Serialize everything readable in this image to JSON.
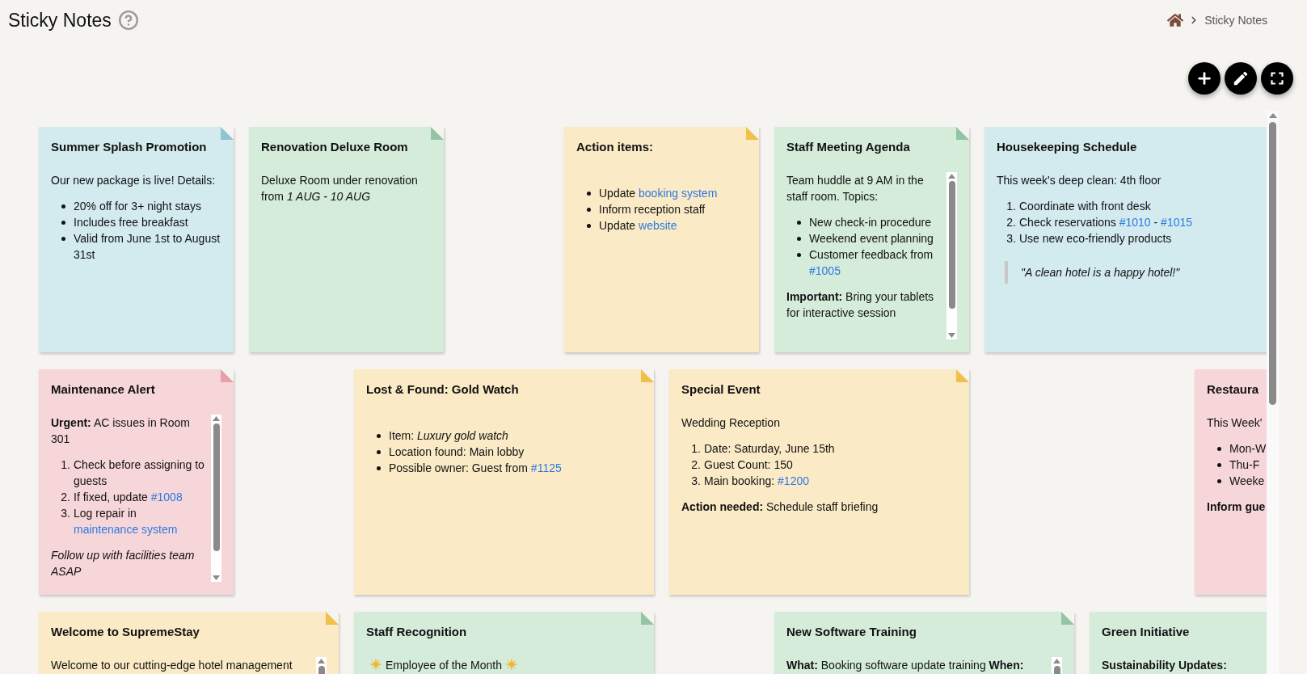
{
  "header": {
    "title": "Sticky Notes",
    "breadcrumb": [
      "Sticky Notes"
    ]
  },
  "notes": [
    {
      "title": "Summer Splash Promotion",
      "color": "#d3eaef",
      "scrollable": false,
      "blocks": [
        {
          "kind": "p",
          "segments": [
            {
              "kind": "text",
              "text": "Our new package is live! Details:"
            }
          ]
        },
        {
          "kind": "ul",
          "items": [
            [
              {
                "kind": "text",
                "text": "20% off for 3+ night stays"
              }
            ],
            [
              {
                "kind": "text",
                "text": "Includes free breakfast"
              }
            ],
            [
              {
                "kind": "text",
                "text": "Valid from June 1st to August 31st"
              }
            ]
          ]
        }
      ]
    },
    {
      "title": "Renovation Deluxe Room",
      "color": "#d5ecdb",
      "scrollable": false,
      "blocks": [
        {
          "kind": "p",
          "segments": [
            {
              "kind": "text",
              "text": "Deluxe Room under renovation from *1 AUG - 10 AUG*"
            }
          ]
        }
      ]
    },
    {
      "title": "Action items:",
      "color": "#fbeac6",
      "scrollable": false,
      "blocks": [
        {
          "kind": "gap"
        },
        {
          "kind": "ul",
          "items": [
            [
              {
                "kind": "text",
                "text": "Update "
              },
              {
                "kind": "link",
                "text": "booking system"
              }
            ],
            [
              {
                "kind": "text",
                "text": "Inform reception staff"
              }
            ],
            [
              {
                "kind": "text",
                "text": "Update "
              },
              {
                "kind": "link",
                "text": "website"
              }
            ]
          ]
        }
      ]
    },
    {
      "title": "Staff Meeting Agenda",
      "color": "#d5ecdb",
      "scrollable": true,
      "blocks": [
        {
          "kind": "p",
          "segments": [
            {
              "kind": "text",
              "text": "Team huddle at 9 AM in the staff room. Topics:"
            }
          ]
        },
        {
          "kind": "ul",
          "items": [
            [
              {
                "kind": "text",
                "text": "New check-in procedure"
              }
            ],
            [
              {
                "kind": "text",
                "text": "Weekend event planning"
              }
            ],
            [
              {
                "kind": "text",
                "text": "Customer feedback from "
              },
              {
                "kind": "link",
                "text": "#1005"
              }
            ]
          ]
        },
        {
          "kind": "p",
          "segments": [
            {
              "kind": "text",
              "text": "**Important:** Bring your tablets for interactive session"
            }
          ]
        }
      ]
    },
    {
      "title": "Housekeeping Schedule",
      "color": "#d3eaef",
      "scrollable": false,
      "blocks": [
        {
          "kind": "p",
          "segments": [
            {
              "kind": "text",
              "text": "This week's deep clean: 4th floor"
            }
          ]
        },
        {
          "kind": "ol",
          "markers": [
            "1.",
            "2.",
            "3."
          ],
          "items": [
            [
              {
                "kind": "text",
                "text": "Coordinate with front desk"
              }
            ],
            [
              {
                "kind": "text",
                "text": "Check reservations "
              },
              {
                "kind": "link",
                "text": "#1010"
              },
              {
                "kind": "text",
                "text": " - "
              },
              {
                "kind": "link",
                "text": "#1015"
              }
            ],
            [
              {
                "kind": "text",
                "text": "Use new eco-friendly products"
              }
            ]
          ]
        },
        {
          "kind": "quote",
          "segments": [
            {
              "kind": "text",
              "text": "\"A clean hotel is a happy hotel!\""
            }
          ]
        }
      ]
    },
    {
      "title": "Maintenance Alert",
      "color": "#f7d6da",
      "scrollable": true,
      "blocks": [
        {
          "kind": "p",
          "segments": [
            {
              "kind": "text",
              "text": "**Urgent:** AC issues in Room 301"
            }
          ]
        },
        {
          "kind": "ol",
          "markers": [
            "1.",
            "2.",
            "3."
          ],
          "items": [
            [
              {
                "kind": "text",
                "text": "Check before assigning to guests"
              }
            ],
            [
              {
                "kind": "text",
                "text": "If fixed, update "
              },
              {
                "kind": "link",
                "text": "#1008"
              }
            ],
            [
              {
                "kind": "text",
                "text": "Log repair in "
              },
              {
                "kind": "link",
                "text": "maintenance system"
              }
            ]
          ]
        },
        {
          "kind": "em",
          "segments": [
            {
              "kind": "text",
              "text": "Follow up with facilities team ASAP"
            }
          ]
        }
      ]
    },
    {
      "title": "Lost & Found: Gold Watch",
      "color": "#fbeac6",
      "scrollable": false,
      "blocks": [
        {
          "kind": "gap"
        },
        {
          "kind": "ul",
          "items": [
            [
              {
                "kind": "text",
                "text": "Item: *Luxury gold watch*"
              }
            ],
            [
              {
                "kind": "text",
                "text": "Location found: Main lobby"
              }
            ],
            [
              {
                "kind": "text",
                "text": "Possible owner: Guest from "
              },
              {
                "kind": "link",
                "text": "#1125"
              }
            ]
          ]
        }
      ]
    },
    {
      "title": "Special Event",
      "color": "#fbeac6",
      "scrollable": false,
      "blocks": [
        {
          "kind": "p",
          "segments": [
            {
              "kind": "text",
              "text": "Wedding Reception"
            }
          ]
        },
        {
          "kind": "ol",
          "markers": [
            "1.",
            "2.",
            "3."
          ],
          "items": [
            [
              {
                "kind": "text",
                "text": "Date: Saturday, June 15th"
              }
            ],
            [
              {
                "kind": "text",
                "text": "Guest Count: 150"
              }
            ],
            [
              {
                "kind": "text",
                "text": "Main booking: "
              },
              {
                "kind": "link",
                "text": "#1200"
              }
            ]
          ]
        },
        {
          "kind": "p",
          "segments": [
            {
              "kind": "text",
              "text": "**Action needed:** Schedule staff briefing"
            }
          ]
        }
      ]
    },
    {
      "title": "Restaura",
      "color": "#f7d6da",
      "blocks": [
        {
          "kind": "p",
          "segments": [
            {
              "kind": "text",
              "text": "This Week'"
            }
          ]
        },
        {
          "kind": "ul",
          "items": [
            [
              {
                "kind": "text",
                "text": "Mon-W"
              }
            ],
            [
              {
                "kind": "text",
                "text": "Thu-F"
              }
            ],
            [
              {
                "kind": "text",
                "text": "Weeke"
              }
            ]
          ]
        },
        {
          "kind": "strong",
          "segments": [
            {
              "kind": "text",
              "text": "Inform gue"
            }
          ]
        }
      ]
    },
    {
      "title": "Welcome to SupremeStay",
      "color": "#fbeac6",
      "scrollable": true,
      "blocks": [
        {
          "kind": "p",
          "segments": [
            {
              "kind": "text",
              "text": "Welcome to our cutting-edge hotel management"
            }
          ]
        }
      ]
    },
    {
      "title": "Staff Recognition",
      "color": "#d5ecdb",
      "scrollable": false,
      "blocks": [
        {
          "kind": "p",
          "segments": [
            {
              "kind": "icon"
            },
            {
              "kind": "text",
              "text": "Employee of the Month"
            },
            {
              "kind": "icon"
            }
          ]
        }
      ]
    },
    {
      "title": "New Software Training",
      "color": "#d5ecdb",
      "scrollable": true,
      "blocks": [
        {
          "kind": "p",
          "segments": [
            {
              "kind": "text",
              "text": "**What:** Booking software update training **When:**"
            }
          ]
        }
      ]
    },
    {
      "title": "Green Initiative",
      "color": "#d5ecdb",
      "blocks": [
        {
          "kind": "strong",
          "segments": [
            {
              "kind": "text",
              "text": "Sustainability Updates:"
            }
          ]
        }
      ]
    }
  ]
}
